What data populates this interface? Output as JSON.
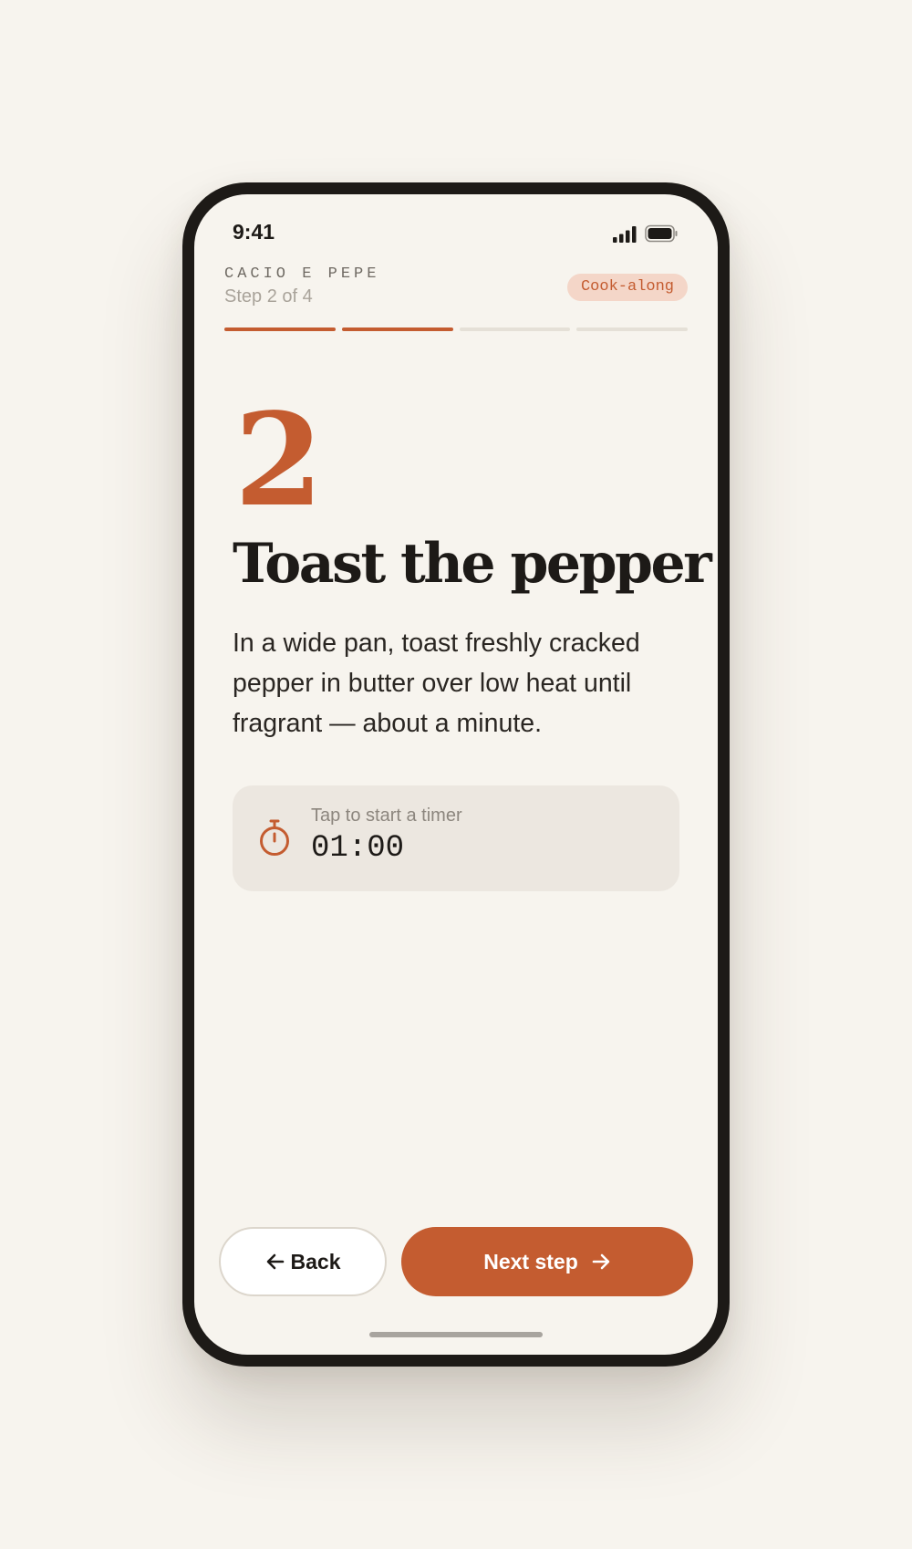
{
  "status_bar": {
    "time": "9:41"
  },
  "header": {
    "recipe_name": "CACIO E PEPE",
    "step_counter": "Step 2 of 4",
    "badge": "Cook-along"
  },
  "progress": {
    "current_step": 2,
    "total_steps": 4
  },
  "step": {
    "number": "2",
    "title": "Toast the pepper",
    "description": "In a wide pan, toast freshly cracked pepper in butter over low heat until fragrant — about a minute."
  },
  "timer": {
    "hint": "Tap to start a timer",
    "value": "01:00",
    "icon": "stopwatch-icon"
  },
  "actions": {
    "back_label": "Back",
    "next_label": "Next step"
  },
  "colors": {
    "accent": "#c45c30",
    "background": "#f7f4ee",
    "ink": "#1d1a17",
    "card": "#ece7e0",
    "badge_bg": "#f4d6c8"
  }
}
